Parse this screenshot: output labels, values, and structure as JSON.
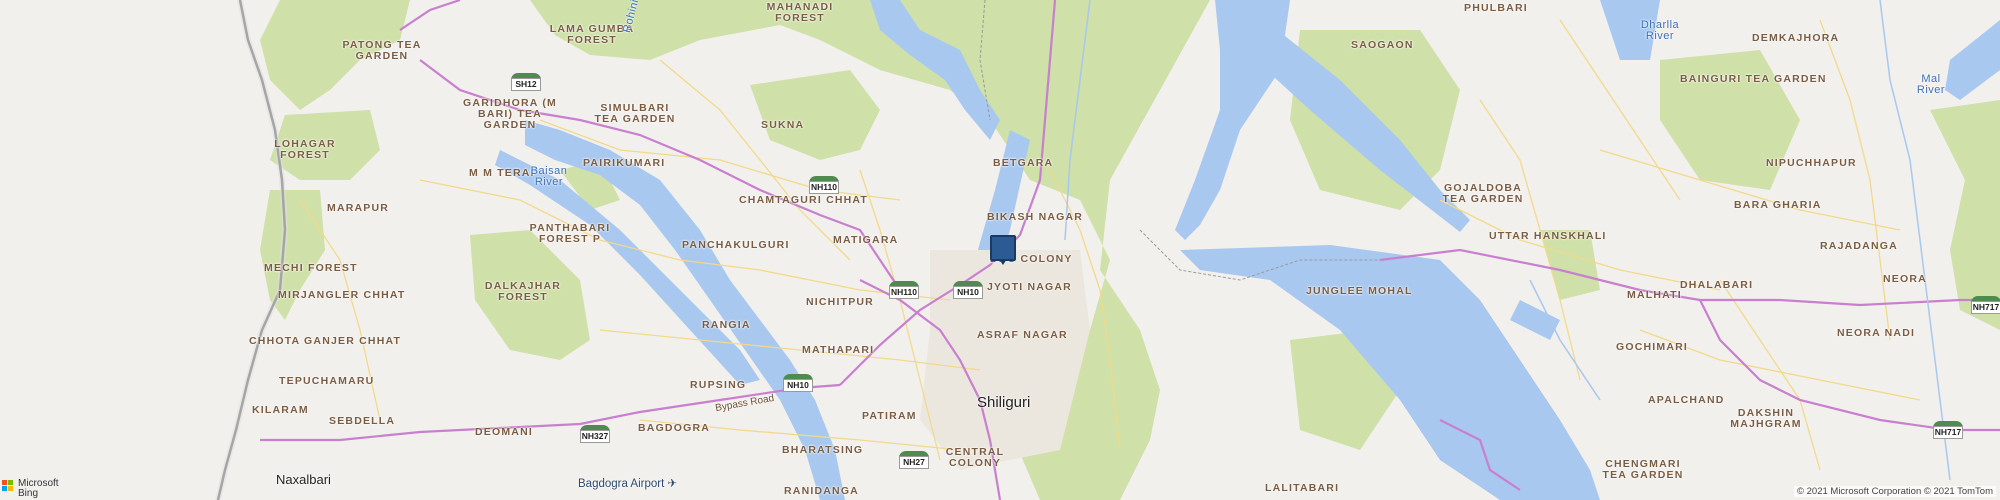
{
  "map": {
    "provider": "Microsoft Bing",
    "copyright": "© 2021 Microsoft Corporation © 2021 TomTom",
    "colors": {
      "land": "#f2f0ec",
      "forest": "#cfe0a8",
      "water": "#a8c8ef",
      "road": "#f2d98a",
      "highway": "#c97fcf",
      "pin": "#2c5a93"
    },
    "pin": {
      "name": "location-pin"
    }
  },
  "logo": {
    "line1": "Microsoft",
    "line2": "Bing"
  },
  "labels": {
    "mahanadi_forest": "MAHANADI\nFOREST",
    "lama_gumba_forest": "LAMA GUMBA\nFOREST",
    "patong_tea_garden": "PATONG TEA\nGARDEN",
    "rohini": "Rohini",
    "garidhora": "GARIDHORA (M\nBARI) TEA\nGARDEN",
    "simulbari": "SIMULBARI\nTEA GARDEN",
    "sukna": "SUKNA",
    "pairikumari": "PAIRIKUMARI",
    "lohagar_forest": "LOHAGAR\nFOREST",
    "m_m_terai": "M M TERAI",
    "baisan_river": "Baisan\nRiver",
    "marapur": "MARAPUR",
    "chamtaguri": "CHAMTAGURI CHHAT",
    "matigara": "MATIGARA",
    "panthabari": "PANTHABARI\nFOREST P",
    "panchakulguri": "PANCHAKULGURI",
    "mechi_forest": "MECHI FOREST",
    "nichitpur": "NICHITPUR",
    "mirjangler": "MIRJANGLER CHHAT",
    "dalkajhar": "DALKAJHAR\nFOREST",
    "rangia": "RANGIA",
    "chhota_ganjer": "CHHOTA GANJER CHHAT",
    "tepuchamaru": "TEPUCHAMARU",
    "mathapari": "MATHAPARI",
    "rupsing": "RUPSING",
    "kilaram": "KILARAM",
    "sebdella": "SEBDELLA",
    "deomani": "DEOMANI",
    "bagdogra": "BAGDOGRA",
    "bypass_road": "Bypass Road",
    "patiram": "PATIRAM",
    "bharatsing": "BHARATSING",
    "central_colony": "CENTRAL\nCOLONY",
    "naxalbari": "Naxalbari",
    "bagdogra_airport": "Bagdogra Airport ✈",
    "ranidanga": "RANIDANGA",
    "siliguri": "Shiliguri",
    "betgara": "BETGARA",
    "bikash_nagar": "BIKASH NAGAR",
    "dbc_colony": "DBC COLONY",
    "jyoti_nagar": "JYOTI NAGAR",
    "asraf_nagar": "ASRAF NAGAR",
    "saogaon": "SAOGAON",
    "junglee_mohal": "JUNGLEE MOHAL",
    "lalitabari": "LALITABARI",
    "phulbari": "PHULBARI",
    "dharlla_river": "Dharlla\nRiver",
    "demkajhora": "DEMKAJHORA",
    "bainguri": "BAINGURI TEA GARDEN",
    "mal_river": "Mal\nRiver",
    "gojaldoba": "GOJALDOBA\nTEA GARDEN",
    "nipuchhapur": "NIPUCHHAPUR",
    "bara_gharia": "BARA GHARIA",
    "uttar_hanskhali": "UTTAR HANSKHALI",
    "rajadanga": "RAJADANGA",
    "dhalabari": "DHALABARI",
    "neora": "NEORA",
    "malhati": "MALHATI",
    "neora_nadi": "NEORA NADI",
    "gochimari": "GOCHIMARI",
    "apalchand": "APALCHAND",
    "dakshin_majhgram": "DAKSHIN\nMAJHGRAM",
    "chengmari": "CHENGMARI\nTEA GARDEN"
  },
  "shields": {
    "sh12": "SH12",
    "nh110_a": "NH110",
    "nh110_b": "NH110",
    "nh10_a": "NH10",
    "nh10_b": "NH10",
    "nh327": "NH327",
    "nh27": "NH27",
    "nh717_a": "NH717",
    "nh717_b": "NH717"
  }
}
